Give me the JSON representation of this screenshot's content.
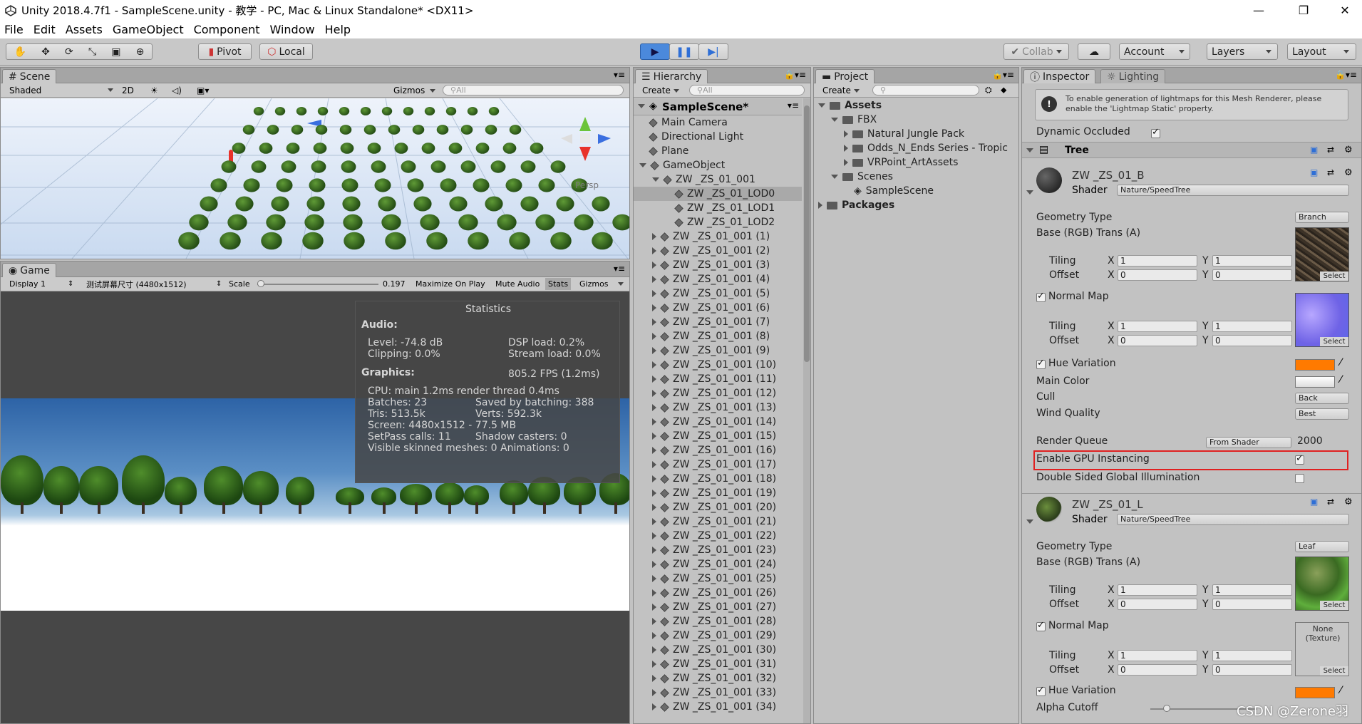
{
  "window": {
    "title": "Unity 2018.4.7f1 - SampleScene.unity - 教学 - PC, Mac & Linux Standalone* <DX11>",
    "min": "—",
    "max": "❐",
    "close": "✕"
  },
  "menu": [
    "File",
    "Edit",
    "Assets",
    "GameObject",
    "Component",
    "Window",
    "Help"
  ],
  "toolbar": {
    "pivot": "Pivot",
    "local": "Local",
    "collab": "Collab",
    "account": "Account",
    "layers": "Layers",
    "layout": "Layout"
  },
  "scene": {
    "tab": "Scene",
    "shading": "Shaded",
    "mode2d": "2D",
    "gizmos": "Gizmos",
    "search": "All",
    "persp": "Persp"
  },
  "game": {
    "tab": "Game",
    "display": "Display 1",
    "resolution": "测试屏幕尺寸 (4480x1512)",
    "scale_label": "Scale",
    "scale_value": "0.197",
    "maximize": "Maximize On Play",
    "mute": "Mute Audio",
    "stats": "Stats",
    "gizmos": "Gizmos"
  },
  "statistics": {
    "title": "Statistics",
    "audio_header": "Audio:",
    "level": "Level: -74.8 dB",
    "clipping": "Clipping: 0.0%",
    "dsp": "DSP load: 0.2%",
    "stream": "Stream load: 0.0%",
    "graphics_header": "Graphics:",
    "fps": "805.2 FPS (1.2ms)",
    "cpu": "CPU: main 1.2ms  render thread 0.4ms",
    "batches": "Batches: 23",
    "saved": "Saved by batching: 388",
    "tris": "Tris: 513.5k",
    "verts": "Verts: 592.3k",
    "screen": "Screen: 4480x1512 - 77.5 MB",
    "setpass": "SetPass calls: 11",
    "shadow": "Shadow casters: 0",
    "skinned": "Visible skinned meshes: 0  Animations: 0"
  },
  "hierarchy": {
    "tab": "Hierarchy",
    "create": "Create",
    "search": "All",
    "scene_name": "SampleScene*",
    "items": [
      {
        "label": "Main Camera",
        "depth": 1
      },
      {
        "label": "Directional Light",
        "depth": 1
      },
      {
        "label": "Plane",
        "depth": 1
      },
      {
        "label": "GameObject",
        "depth": 1
      },
      {
        "label": "ZW _ZS_01_001",
        "depth": 2
      },
      {
        "label": "ZW _ZS_01_LOD0",
        "depth": 3
      },
      {
        "label": "ZW _ZS_01_LOD1",
        "depth": 3
      },
      {
        "label": "ZW _ZS_01_LOD2",
        "depth": 3
      },
      {
        "label": "ZW _ZS_01_001 (1)",
        "depth": 2
      },
      {
        "label": "ZW _ZS_01_001 (2)",
        "depth": 2
      },
      {
        "label": "ZW _ZS_01_001 (3)",
        "depth": 2
      },
      {
        "label": "ZW _ZS_01_001 (4)",
        "depth": 2
      },
      {
        "label": "ZW _ZS_01_001 (5)",
        "depth": 2
      },
      {
        "label": "ZW _ZS_01_001 (6)",
        "depth": 2
      },
      {
        "label": "ZW _ZS_01_001 (7)",
        "depth": 2
      },
      {
        "label": "ZW _ZS_01_001 (8)",
        "depth": 2
      },
      {
        "label": "ZW _ZS_01_001 (9)",
        "depth": 2
      },
      {
        "label": "ZW _ZS_01_001 (10)",
        "depth": 2
      },
      {
        "label": "ZW _ZS_01_001 (11)",
        "depth": 2
      },
      {
        "label": "ZW _ZS_01_001 (12)",
        "depth": 2
      },
      {
        "label": "ZW _ZS_01_001 (13)",
        "depth": 2
      },
      {
        "label": "ZW _ZS_01_001 (14)",
        "depth": 2
      },
      {
        "label": "ZW _ZS_01_001 (15)",
        "depth": 2
      },
      {
        "label": "ZW _ZS_01_001 (16)",
        "depth": 2
      },
      {
        "label": "ZW _ZS_01_001 (17)",
        "depth": 2
      },
      {
        "label": "ZW _ZS_01_001 (18)",
        "depth": 2
      },
      {
        "label": "ZW _ZS_01_001 (19)",
        "depth": 2
      },
      {
        "label": "ZW _ZS_01_001 (20)",
        "depth": 2
      },
      {
        "label": "ZW _ZS_01_001 (21)",
        "depth": 2
      },
      {
        "label": "ZW _ZS_01_001 (22)",
        "depth": 2
      },
      {
        "label": "ZW _ZS_01_001 (23)",
        "depth": 2
      },
      {
        "label": "ZW _ZS_01_001 (24)",
        "depth": 2
      },
      {
        "label": "ZW _ZS_01_001 (25)",
        "depth": 2
      },
      {
        "label": "ZW _ZS_01_001 (26)",
        "depth": 2
      },
      {
        "label": "ZW _ZS_01_001 (27)",
        "depth": 2
      },
      {
        "label": "ZW _ZS_01_001 (28)",
        "depth": 2
      },
      {
        "label": "ZW _ZS_01_001 (29)",
        "depth": 2
      },
      {
        "label": "ZW _ZS_01_001 (30)",
        "depth": 2
      },
      {
        "label": "ZW _ZS_01_001 (31)",
        "depth": 2
      },
      {
        "label": "ZW _ZS_01_001 (32)",
        "depth": 2
      },
      {
        "label": "ZW _ZS_01_001 (33)",
        "depth": 2
      },
      {
        "label": "ZW _ZS_01_001 (34)",
        "depth": 2
      }
    ]
  },
  "project": {
    "tab": "Project",
    "create": "Create",
    "items": [
      {
        "label": "Assets",
        "depth": 0,
        "bold": true
      },
      {
        "label": "FBX",
        "depth": 1
      },
      {
        "label": "Natural Jungle Pack",
        "depth": 2
      },
      {
        "label": "Odds_N_Ends Series - Tropic",
        "depth": 2
      },
      {
        "label": "VRPoint_ArtAssets",
        "depth": 2
      },
      {
        "label": "Scenes",
        "depth": 1
      },
      {
        "label": "SampleScene",
        "depth": 2
      },
      {
        "label": "Packages",
        "depth": 0,
        "bold": true
      }
    ]
  },
  "inspector": {
    "tab": "Inspector",
    "lighting_tab": "Lighting",
    "notice": "To enable generation of lightmaps for this Mesh Renderer, please enable the 'Lightmap Static' property.",
    "dynamic_occluded": "Dynamic Occluded",
    "component": "Tree",
    "mat1": {
      "name": "ZW _ZS_01_B",
      "shader_label": "Shader",
      "shader": "Nature/SpeedTree",
      "geometry_type_label": "Geometry Type",
      "geometry_type": "Branch",
      "base_label": "Base (RGB) Trans (A)",
      "tiling": "Tiling",
      "offset": "Offset",
      "x": "X",
      "y": "Y",
      "one": "1",
      "zero": "0",
      "normal_map": "Normal Map",
      "hue_variation": "Hue Variation",
      "main_color": "Main Color",
      "cull": "Cull",
      "cull_value": "Back",
      "wind_quality": "Wind Quality",
      "wind_value": "Best",
      "render_queue": "Render Queue",
      "render_queue_mode": "From Shader",
      "render_queue_value": "2000",
      "gpu_instancing": "Enable GPU Instancing",
      "double_sided": "Double Sided Global Illumination",
      "select": "Select"
    },
    "mat2": {
      "name": "ZW _ZS_01_L",
      "shader_label": "Shader",
      "shader": "Nature/SpeedTree",
      "geometry_type_label": "Geometry Type",
      "geometry_type": "Leaf",
      "base_label": "Base (RGB) Trans (A)",
      "tiling": "Tiling",
      "offset": "Offset",
      "normal_map": "Normal Map",
      "none_texture": "None (Texture)",
      "hue_variation": "Hue Variation",
      "alpha_cutoff": "Alpha Cutoff",
      "select": "Select"
    }
  },
  "watermark": "CSDN @Zerone羽",
  "colors": {
    "highlight_box": "#e02020",
    "hue_orange": "#ff7a00",
    "accent_blue": "#2f6fd6"
  }
}
